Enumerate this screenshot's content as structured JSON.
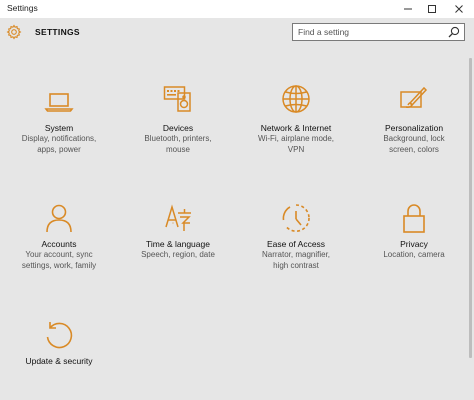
{
  "window": {
    "title": "Settings"
  },
  "header": {
    "title": "SETTINGS",
    "search_placeholder": "Find a setting"
  },
  "accent_color": "#d98a26",
  "categories": [
    {
      "name": "System",
      "desc": [
        "Display, notifications,",
        "apps, power"
      ],
      "icon": "laptop-icon"
    },
    {
      "name": "Devices",
      "desc": [
        "Bluetooth, printers,",
        "mouse"
      ],
      "icon": "keyboard-speaker-icon"
    },
    {
      "name": "Network & Internet",
      "desc": [
        "Wi-Fi, airplane mode,",
        "VPN"
      ],
      "icon": "globe-icon"
    },
    {
      "name": "Personalization",
      "desc": [
        "Background, lock",
        "screen, colors"
      ],
      "icon": "paint-brush-icon"
    },
    {
      "name": "Accounts",
      "desc": [
        "Your account, sync",
        "settings, work, family"
      ],
      "icon": "person-icon"
    },
    {
      "name": "Time & language",
      "desc": [
        "Speech, region, date"
      ],
      "icon": "time-language-icon"
    },
    {
      "name": "Ease of Access",
      "desc": [
        "Narrator, magnifier,",
        "high contrast"
      ],
      "icon": "ease-of-access-icon"
    },
    {
      "name": "Privacy",
      "desc": [
        "Location, camera"
      ],
      "icon": "padlock-icon"
    },
    {
      "name": "Update & security",
      "desc": [],
      "icon": "refresh-icon"
    }
  ]
}
